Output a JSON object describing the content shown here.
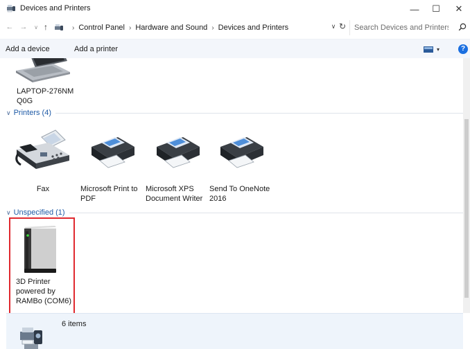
{
  "window": {
    "title": "Devices and Printers",
    "minimize": "—",
    "maximize": "☐",
    "close": "✕"
  },
  "address": {
    "crumbs": [
      "Control Panel",
      "Hardware and Sound",
      "Devices and Printers"
    ],
    "search_placeholder": "Search Devices and Printers"
  },
  "toolbar": {
    "add_device": "Add a device",
    "add_printer": "Add a printer"
  },
  "groups": {
    "devices": {
      "items": [
        {
          "label_line1": "LAPTOP-276NM",
          "label_line2": "Q0G",
          "icon": "laptop-icon"
        }
      ]
    },
    "printers": {
      "header": "Printers (4)",
      "items": [
        {
          "label_line1": "Fax",
          "label_line2": "",
          "icon": "fax-icon"
        },
        {
          "label_line1": "Microsoft Print to",
          "label_line2": "PDF",
          "icon": "printer-icon"
        },
        {
          "label_line1": "Microsoft XPS",
          "label_line2": "Document Writer",
          "icon": "printer-icon"
        },
        {
          "label_line1": "Send To OneNote",
          "label_line2": "2016",
          "icon": "printer-icon"
        }
      ]
    },
    "unspecified": {
      "header": "Unspecified (1)",
      "items": [
        {
          "label_line1": "3D Printer",
          "label_line2": "powered by",
          "label_line3": "RAMBo (COM6)",
          "icon": "3d-printer-icon",
          "selected": true
        }
      ]
    }
  },
  "status": {
    "count": "6 items",
    "icon": "devices-printers-icon"
  },
  "colors": {
    "accent": "#1e5aa6",
    "selection_outline": "#e0282e",
    "command_bar": "#f3f6fb",
    "status_bar": "#eef4fb",
    "help": "#1a6fe0"
  }
}
